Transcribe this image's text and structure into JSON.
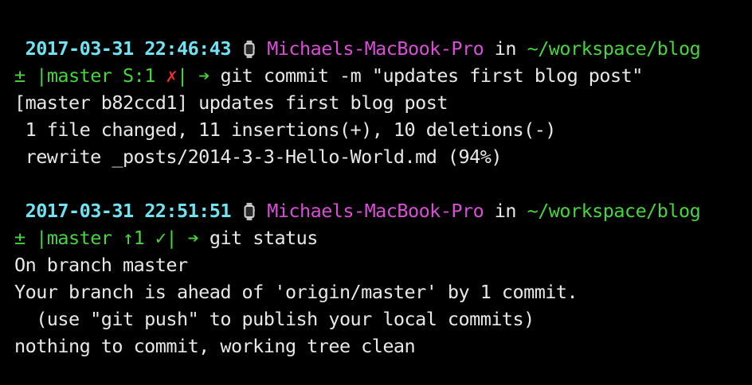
{
  "colors": {
    "background": "#000000",
    "timestamp": "#6fe3f2",
    "hostname": "#d84fd6",
    "path": "#48d43e",
    "branch": "#48d43e",
    "dirty": "#e8312a",
    "text": "#e8e8e8"
  },
  "prompt1": {
    "timestamp": "2017-03-31 22:46:43",
    "icon": "watch-icon",
    "hostname": "Michaels-MacBook-Pro",
    "in_word": "in",
    "path": "~/workspace/blog",
    "plusminus": "±",
    "branch": "|master S:1",
    "status_mark": "✗",
    "close_bar": "|",
    "arrow": "➔",
    "command": "git commit -m \"updates first blog post\""
  },
  "output1": [
    "[master b82ccd1] updates first blog post",
    " 1 file changed, 11 insertions(+), 10 deletions(-)",
    " rewrite _posts/2014-3-3-Hello-World.md (94%)"
  ],
  "prompt2": {
    "timestamp": "2017-03-31 22:51:51",
    "icon": "watch-icon",
    "hostname": "Michaels-MacBook-Pro",
    "in_word": "in",
    "path": "~/workspace/blog",
    "plusminus": "±",
    "branch": "|master ↑1",
    "status_mark": "✓",
    "close_bar": "|",
    "arrow": "➔",
    "command": "git status"
  },
  "output2": [
    "On branch master",
    "Your branch is ahead of 'origin/master' by 1 commit.",
    "  (use \"git push\" to publish your local commits)",
    "nothing to commit, working tree clean"
  ]
}
